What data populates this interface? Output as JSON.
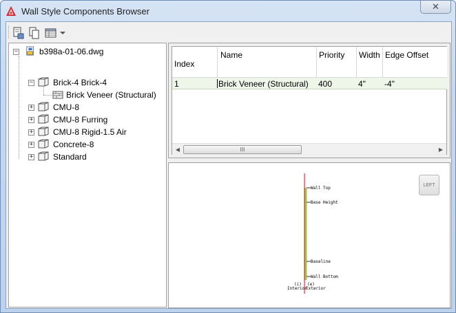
{
  "window": {
    "title": "Wall Style Components Browser",
    "close_glyph": "✕"
  },
  "toolbar": {
    "icons": [
      "import-icon",
      "copy-icon",
      "table-view-icon",
      "dropdown-arrow-icon"
    ]
  },
  "tree": {
    "root": "b398a-01-06.dwg",
    "items": [
      {
        "label": "Brick-4 Brick-4",
        "expanded": true
      },
      {
        "label": "Brick Veneer (Structural)",
        "child": true
      },
      {
        "label": "CMU-8",
        "expanded": false
      },
      {
        "label": "CMU-8 Furring",
        "expanded": false
      },
      {
        "label": "CMU-8 Rigid-1.5 Air",
        "expanded": false
      },
      {
        "label": "Concrete-8",
        "expanded": false
      },
      {
        "label": "Standard",
        "expanded": false
      }
    ]
  },
  "grid": {
    "columns": [
      "Index",
      "Name",
      "Priority",
      "Width",
      "Edge Offset"
    ],
    "rows": [
      {
        "index": "1",
        "name": "Brick Veneer (Structural)",
        "priority": "400",
        "width": "4\"",
        "edge_offset": "-4\""
      }
    ],
    "scroll_grip": "III"
  },
  "preview": {
    "view_button": "LEFT",
    "labels": {
      "wall_top": "Wall Top",
      "base_height": "Base Height",
      "baseline": "Baseline",
      "wall_bottom": "Wall Bottom",
      "exterior_marker": "(e)",
      "exterior": "Exterior",
      "interior_marker": "(i)",
      "interior": "Interior"
    },
    "colors": {
      "axis": "#e8001c",
      "component": "#8fd14f"
    }
  }
}
